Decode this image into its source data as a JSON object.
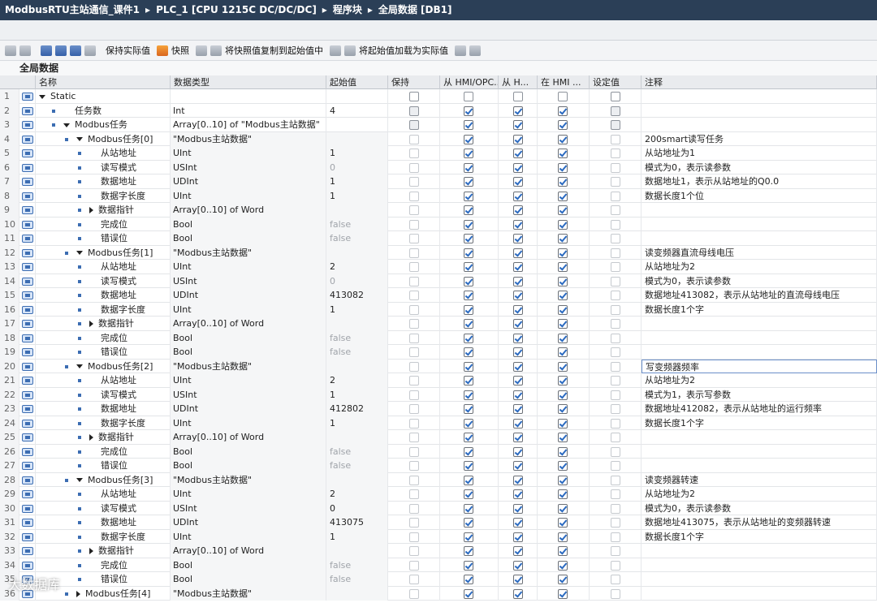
{
  "title_bar": {
    "crumbs": [
      "ModbusRTU主站通信_课件1",
      "PLC_1 [CPU 1215C DC/DC/DC]",
      "程序块",
      "全局数据 [DB1]"
    ],
    "separator": "▸"
  },
  "toolbar": {
    "keep_actual": "保持实际值",
    "snapshot": "快照",
    "copy_snapshot": "将快照值复制到起始值中",
    "load_start": "将起始值加载为实际值"
  },
  "section_title": "全局数据",
  "columns": {
    "name": "名称",
    "type": "数据类型",
    "start": "起始值",
    "retain": "保持",
    "hmi_opc": "从 HMI/OPC...",
    "from_h": "从 H...",
    "in_hmi": "在 HMI ...",
    "setpoint": "设定值",
    "comment": "注释"
  },
  "rows": [
    {
      "n": "1",
      "lvl": 0,
      "kind": "expand",
      "name": "Static",
      "type": "",
      "start": "",
      "checks": [
        0,
        0,
        0,
        0,
        0
      ],
      "cmt": "",
      "sub": false
    },
    {
      "n": "2",
      "lvl": 1,
      "kind": "leaf",
      "name": "任务数",
      "type": "Int",
      "start": "4",
      "checks": [
        0,
        1,
        1,
        1,
        0
      ],
      "cmt": "",
      "sub": false
    },
    {
      "n": "3",
      "lvl": 1,
      "kind": "expand",
      "name": "Modbus任务",
      "type": "Array[0..10] of \"Modbus主站数据\"",
      "start": "",
      "checks": [
        0,
        1,
        1,
        1,
        0
      ],
      "cmt": "",
      "sub": false
    },
    {
      "n": "4",
      "lvl": 2,
      "kind": "expand",
      "name": "Modbus任务[0]",
      "type": "\"Modbus主站数据\"",
      "start": "",
      "checks": [
        0,
        1,
        1,
        1,
        0
      ],
      "cmt": "200smart读写任务",
      "sub": true
    },
    {
      "n": "5",
      "lvl": 3,
      "kind": "leaf",
      "name": "从站地址",
      "type": "UInt",
      "start": "1",
      "checks": [
        0,
        1,
        1,
        1,
        0
      ],
      "cmt": "从站地址为1",
      "sub": true
    },
    {
      "n": "6",
      "lvl": 3,
      "kind": "leaf",
      "name": "读写模式",
      "type": "USInt",
      "start": "0",
      "checks": [
        0,
        1,
        1,
        1,
        0
      ],
      "cmt": "模式为0，表示读参数",
      "sub": true,
      "grey": true
    },
    {
      "n": "7",
      "lvl": 3,
      "kind": "leaf",
      "name": "数据地址",
      "type": "UDInt",
      "start": "1",
      "checks": [
        0,
        1,
        1,
        1,
        0
      ],
      "cmt": "数据地址1，表示从站地址的Q0.0",
      "sub": true
    },
    {
      "n": "8",
      "lvl": 3,
      "kind": "leaf",
      "name": "数据字长度",
      "type": "UInt",
      "start": "1",
      "checks": [
        0,
        1,
        1,
        1,
        0
      ],
      "cmt": "数据长度1个位",
      "sub": true
    },
    {
      "n": "9",
      "lvl": 3,
      "kind": "collapsed",
      "name": "数据指针",
      "type": "Array[0..10] of Word",
      "start": "",
      "checks": [
        0,
        1,
        1,
        1,
        0
      ],
      "cmt": "",
      "sub": true
    },
    {
      "n": "10",
      "lvl": 3,
      "kind": "leaf",
      "name": "完成位",
      "type": "Bool",
      "start": "false",
      "checks": [
        0,
        1,
        1,
        1,
        0
      ],
      "cmt": "",
      "sub": true,
      "grey": true
    },
    {
      "n": "11",
      "lvl": 3,
      "kind": "leaf",
      "name": "错误位",
      "type": "Bool",
      "start": "false",
      "checks": [
        0,
        1,
        1,
        1,
        0
      ],
      "cmt": "",
      "sub": true,
      "grey": true
    },
    {
      "n": "12",
      "lvl": 2,
      "kind": "expand",
      "name": "Modbus任务[1]",
      "type": "\"Modbus主站数据\"",
      "start": "",
      "checks": [
        0,
        1,
        1,
        1,
        0
      ],
      "cmt": "读变频器直流母线电压",
      "sub": true
    },
    {
      "n": "13",
      "lvl": 3,
      "kind": "leaf",
      "name": "从站地址",
      "type": "UInt",
      "start": "2",
      "checks": [
        0,
        1,
        1,
        1,
        0
      ],
      "cmt": "从站地址为2",
      "sub": true
    },
    {
      "n": "14",
      "lvl": 3,
      "kind": "leaf",
      "name": "读写模式",
      "type": "USInt",
      "start": "0",
      "checks": [
        0,
        1,
        1,
        1,
        0
      ],
      "cmt": "模式为0，表示读参数",
      "sub": true,
      "grey": true
    },
    {
      "n": "15",
      "lvl": 3,
      "kind": "leaf",
      "name": "数据地址",
      "type": "UDInt",
      "start": "413082",
      "checks": [
        0,
        1,
        1,
        1,
        0
      ],
      "cmt": "数据地址413082，表示从站地址的直流母线电压",
      "sub": true
    },
    {
      "n": "16",
      "lvl": 3,
      "kind": "leaf",
      "name": "数据字长度",
      "type": "UInt",
      "start": "1",
      "checks": [
        0,
        1,
        1,
        1,
        0
      ],
      "cmt": "数据长度1个字",
      "sub": true
    },
    {
      "n": "17",
      "lvl": 3,
      "kind": "collapsed",
      "name": "数据指针",
      "type": "Array[0..10] of Word",
      "start": "",
      "checks": [
        0,
        1,
        1,
        1,
        0
      ],
      "cmt": "",
      "sub": true
    },
    {
      "n": "18",
      "lvl": 3,
      "kind": "leaf",
      "name": "完成位",
      "type": "Bool",
      "start": "false",
      "checks": [
        0,
        1,
        1,
        1,
        0
      ],
      "cmt": "",
      "sub": true,
      "grey": true
    },
    {
      "n": "19",
      "lvl": 3,
      "kind": "leaf",
      "name": "错误位",
      "type": "Bool",
      "start": "false",
      "checks": [
        0,
        1,
        1,
        1,
        0
      ],
      "cmt": "",
      "sub": true,
      "grey": true
    },
    {
      "n": "20",
      "lvl": 2,
      "kind": "expand",
      "name": "Modbus任务[2]",
      "type": "\"Modbus主站数据\"",
      "start": "",
      "checks": [
        0,
        1,
        1,
        1,
        0
      ],
      "cmt": "写变频器频率",
      "sub": true,
      "edit": true
    },
    {
      "n": "21",
      "lvl": 3,
      "kind": "leaf",
      "name": "从站地址",
      "type": "UInt",
      "start": "2",
      "checks": [
        0,
        1,
        1,
        1,
        0
      ],
      "cmt": "从站地址为2",
      "sub": true
    },
    {
      "n": "22",
      "lvl": 3,
      "kind": "leaf",
      "name": "读写模式",
      "type": "USInt",
      "start": "1",
      "checks": [
        0,
        1,
        1,
        1,
        0
      ],
      "cmt": "模式为1，表示写参数",
      "sub": true
    },
    {
      "n": "23",
      "lvl": 3,
      "kind": "leaf",
      "name": "数据地址",
      "type": "UDInt",
      "start": "412802",
      "checks": [
        0,
        1,
        1,
        1,
        0
      ],
      "cmt": "数据地址412082，表示从站地址的运行频率",
      "sub": true
    },
    {
      "n": "24",
      "lvl": 3,
      "kind": "leaf",
      "name": "数据字长度",
      "type": "UInt",
      "start": "1",
      "checks": [
        0,
        1,
        1,
        1,
        0
      ],
      "cmt": "数据长度1个字",
      "sub": true
    },
    {
      "n": "25",
      "lvl": 3,
      "kind": "collapsed",
      "name": "数据指针",
      "type": "Array[0..10] of Word",
      "start": "",
      "checks": [
        0,
        1,
        1,
        1,
        0
      ],
      "cmt": "",
      "sub": true
    },
    {
      "n": "26",
      "lvl": 3,
      "kind": "leaf",
      "name": "完成位",
      "type": "Bool",
      "start": "false",
      "checks": [
        0,
        1,
        1,
        1,
        0
      ],
      "cmt": "",
      "sub": true,
      "grey": true
    },
    {
      "n": "27",
      "lvl": 3,
      "kind": "leaf",
      "name": "错误位",
      "type": "Bool",
      "start": "false",
      "checks": [
        0,
        1,
        1,
        1,
        0
      ],
      "cmt": "",
      "sub": true,
      "grey": true
    },
    {
      "n": "28",
      "lvl": 2,
      "kind": "expand",
      "name": "Modbus任务[3]",
      "type": "\"Modbus主站数据\"",
      "start": "",
      "checks": [
        0,
        1,
        1,
        1,
        0
      ],
      "cmt": "读变频器转速",
      "sub": true
    },
    {
      "n": "29",
      "lvl": 3,
      "kind": "leaf",
      "name": "从站地址",
      "type": "UInt",
      "start": "2",
      "checks": [
        0,
        1,
        1,
        1,
        0
      ],
      "cmt": "从站地址为2",
      "sub": true
    },
    {
      "n": "30",
      "lvl": 3,
      "kind": "leaf",
      "name": "读写模式",
      "type": "USInt",
      "start": "0",
      "checks": [
        0,
        1,
        1,
        1,
        0
      ],
      "cmt": "模式为0，表示读参数",
      "sub": true
    },
    {
      "n": "31",
      "lvl": 3,
      "kind": "leaf",
      "name": "数据地址",
      "type": "UDInt",
      "start": "413075",
      "checks": [
        0,
        1,
        1,
        1,
        0
      ],
      "cmt": "数据地址413075，表示从站地址的变频器转速",
      "sub": true
    },
    {
      "n": "32",
      "lvl": 3,
      "kind": "leaf",
      "name": "数据字长度",
      "type": "UInt",
      "start": "1",
      "checks": [
        0,
        1,
        1,
        1,
        0
      ],
      "cmt": "数据长度1个字",
      "sub": true
    },
    {
      "n": "33",
      "lvl": 3,
      "kind": "collapsed",
      "name": "数据指针",
      "type": "Array[0..10] of Word",
      "start": "",
      "checks": [
        0,
        1,
        1,
        1,
        0
      ],
      "cmt": "",
      "sub": true
    },
    {
      "n": "34",
      "lvl": 3,
      "kind": "leaf",
      "name": "完成位",
      "type": "Bool",
      "start": "false",
      "checks": [
        0,
        1,
        1,
        1,
        0
      ],
      "cmt": "",
      "sub": true,
      "grey": true
    },
    {
      "n": "35",
      "lvl": 3,
      "kind": "leaf",
      "name": "错误位",
      "type": "Bool",
      "start": "false",
      "checks": [
        0,
        1,
        1,
        1,
        0
      ],
      "cmt": "",
      "sub": true,
      "grey": true
    },
    {
      "n": "36",
      "lvl": 2,
      "kind": "collapsed",
      "name": "Modbus任务[4]",
      "type": "\"Modbus主站数据\"",
      "start": "",
      "checks": [
        0,
        1,
        1,
        1,
        0
      ],
      "cmt": "",
      "sub": true
    }
  ],
  "watermark": "大数据库"
}
